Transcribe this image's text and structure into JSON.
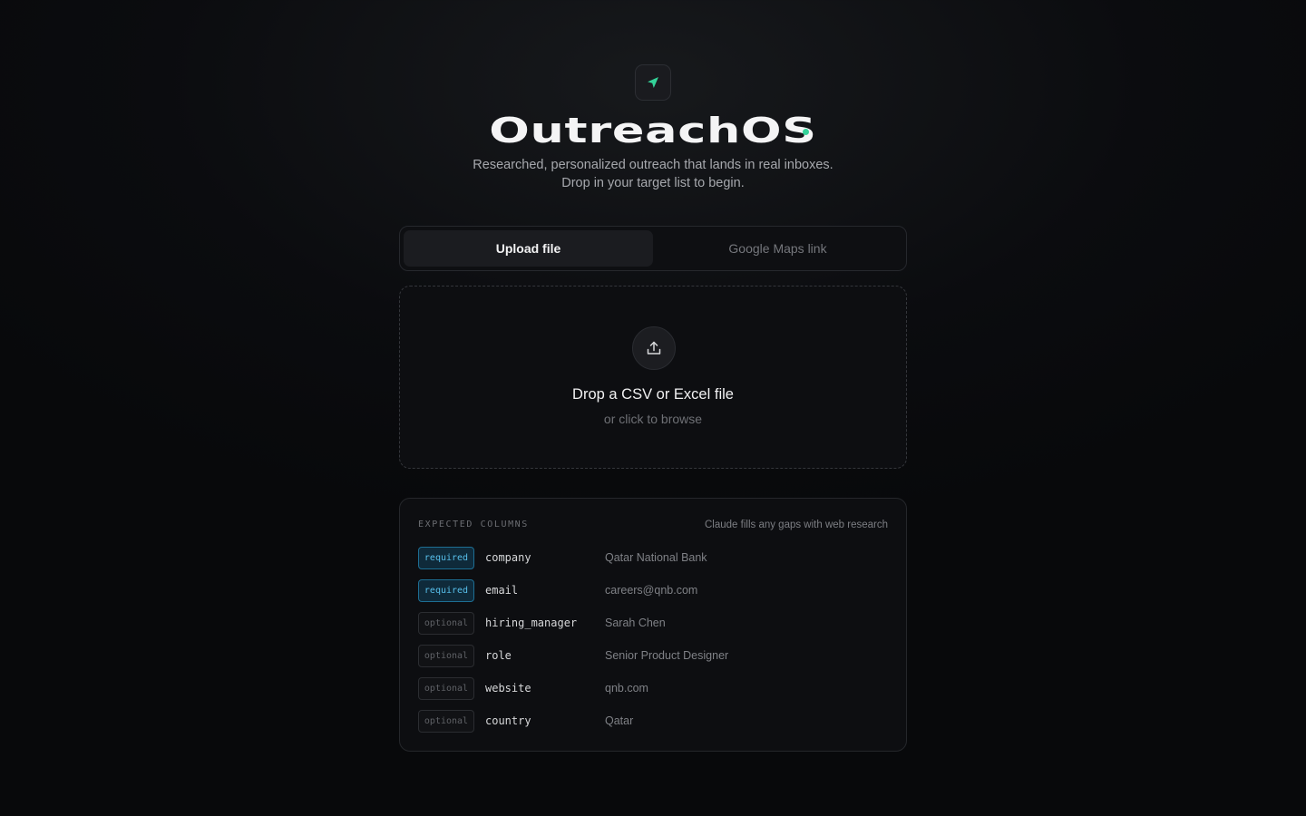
{
  "brand": {
    "icon": "send-arrow-icon",
    "title": "OutreachOS",
    "accent_color": "#34d399",
    "subtitle": "Researched, personalized outreach that lands in real inboxes. Drop in your target list to begin."
  },
  "tabs": [
    {
      "label": "Upload file",
      "active": true
    },
    {
      "label": "Google Maps link",
      "active": false
    }
  ],
  "dropzone": {
    "icon": "upload-icon",
    "title": "Drop a CSV or Excel file",
    "subtitle": "or click to browse"
  },
  "columns": {
    "label": "EXPECTED COLUMNS",
    "note": "Claude fills any gaps with web research",
    "rows": [
      {
        "badge": "required",
        "name": "company",
        "example": "Qatar National Bank"
      },
      {
        "badge": "required",
        "name": "email",
        "example": "careers@qnb.com"
      },
      {
        "badge": "optional",
        "name": "hiring_manager",
        "example": "Sarah Chen"
      },
      {
        "badge": "optional",
        "name": "role",
        "example": "Senior Product Designer"
      },
      {
        "badge": "optional",
        "name": "website",
        "example": "qnb.com"
      },
      {
        "badge": "optional",
        "name": "country",
        "example": "Qatar"
      }
    ]
  }
}
